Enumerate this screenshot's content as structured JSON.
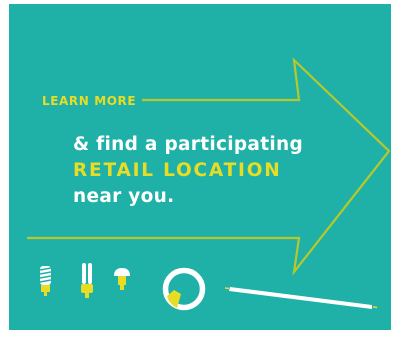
{
  "banner": {
    "cta_label": "LEARN MORE",
    "headline_line1": "& find a participating",
    "headline_line2": "RETAIL LOCATION",
    "headline_line3": "near you."
  },
  "colors": {
    "background": "#1fb1a8",
    "accent": "#e8dd24",
    "text": "#ffffff"
  },
  "icons": [
    "cfl-spiral-bulb-icon",
    "cfl-tube-bulb-icon",
    "led-bulb-icon",
    "circular-fluorescent-bulb-icon",
    "fluorescent-tube-icon"
  ]
}
